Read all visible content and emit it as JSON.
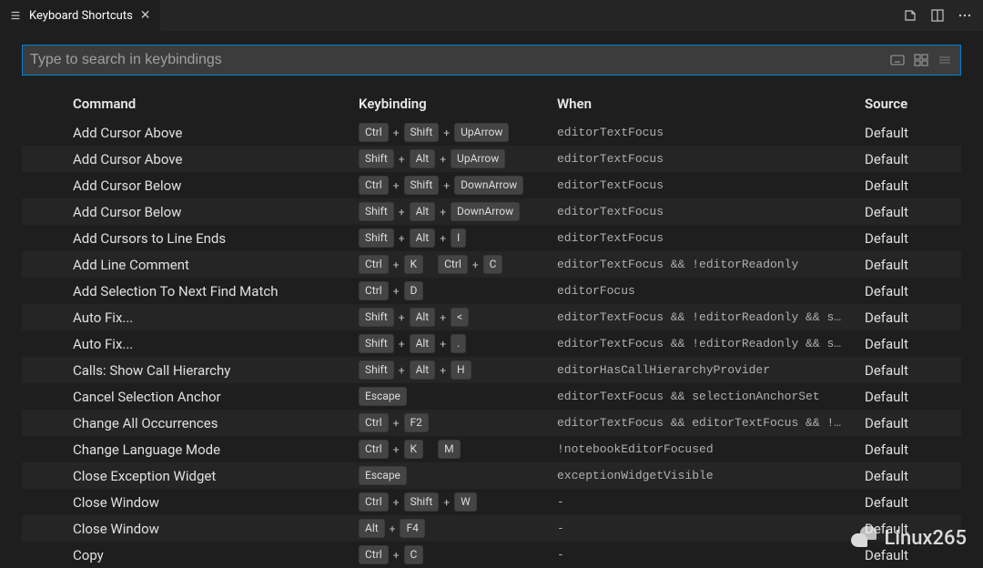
{
  "tab": {
    "title": "Keyboard Shortcuts"
  },
  "search": {
    "placeholder": "Type to search in keybindings"
  },
  "headers": {
    "command": "Command",
    "keybinding": "Keybinding",
    "when": "When",
    "source": "Source"
  },
  "plus": "+",
  "watermark": "Linux265",
  "rows": [
    {
      "command": "Add Cursor Above",
      "chords": [
        [
          "Ctrl",
          "Shift",
          "UpArrow"
        ]
      ],
      "when": "editorTextFocus",
      "source": "Default"
    },
    {
      "command": "Add Cursor Above",
      "chords": [
        [
          "Shift",
          "Alt",
          "UpArrow"
        ]
      ],
      "when": "editorTextFocus",
      "source": "Default"
    },
    {
      "command": "Add Cursor Below",
      "chords": [
        [
          "Ctrl",
          "Shift",
          "DownArrow"
        ]
      ],
      "when": "editorTextFocus",
      "source": "Default"
    },
    {
      "command": "Add Cursor Below",
      "chords": [
        [
          "Shift",
          "Alt",
          "DownArrow"
        ]
      ],
      "when": "editorTextFocus",
      "source": "Default"
    },
    {
      "command": "Add Cursors to Line Ends",
      "chords": [
        [
          "Shift",
          "Alt",
          "I"
        ]
      ],
      "when": "editorTextFocus",
      "source": "Default"
    },
    {
      "command": "Add Line Comment",
      "chords": [
        [
          "Ctrl",
          "K"
        ],
        [
          "Ctrl",
          "C"
        ]
      ],
      "when": "editorTextFocus && !editorReadonly",
      "source": "Default"
    },
    {
      "command": "Add Selection To Next Find Match",
      "chords": [
        [
          "Ctrl",
          "D"
        ]
      ],
      "when": "editorFocus",
      "source": "Default"
    },
    {
      "command": "Auto Fix...",
      "chords": [
        [
          "Shift",
          "Alt",
          "<"
        ]
      ],
      "when": "editorTextFocus && !editorReadonly && s…",
      "source": "Default"
    },
    {
      "command": "Auto Fix...",
      "chords": [
        [
          "Shift",
          "Alt",
          "."
        ]
      ],
      "when": "editorTextFocus && !editorReadonly && s…",
      "source": "Default"
    },
    {
      "command": "Calls: Show Call Hierarchy",
      "chords": [
        [
          "Shift",
          "Alt",
          "H"
        ]
      ],
      "when": "editorHasCallHierarchyProvider",
      "source": "Default"
    },
    {
      "command": "Cancel Selection Anchor",
      "chords": [
        [
          "Escape"
        ]
      ],
      "when": "editorTextFocus && selectionAnchorSet",
      "source": "Default"
    },
    {
      "command": "Change All Occurrences",
      "chords": [
        [
          "Ctrl",
          "F2"
        ]
      ],
      "when": "editorTextFocus && editorTextFocus && !…",
      "source": "Default"
    },
    {
      "command": "Change Language Mode",
      "chords": [
        [
          "Ctrl",
          "K"
        ],
        [
          "M"
        ]
      ],
      "when": "!notebookEditorFocused",
      "source": "Default"
    },
    {
      "command": "Close Exception Widget",
      "chords": [
        [
          "Escape"
        ]
      ],
      "when": "exceptionWidgetVisible",
      "source": "Default"
    },
    {
      "command": "Close Window",
      "chords": [
        [
          "Ctrl",
          "Shift",
          "W"
        ]
      ],
      "when": "-",
      "source": "Default"
    },
    {
      "command": "Close Window",
      "chords": [
        [
          "Alt",
          "F4"
        ]
      ],
      "when": "-",
      "source": "Default"
    },
    {
      "command": "Copy",
      "chords": [
        [
          "Ctrl",
          "C"
        ]
      ],
      "when": "-",
      "source": "Default"
    }
  ]
}
